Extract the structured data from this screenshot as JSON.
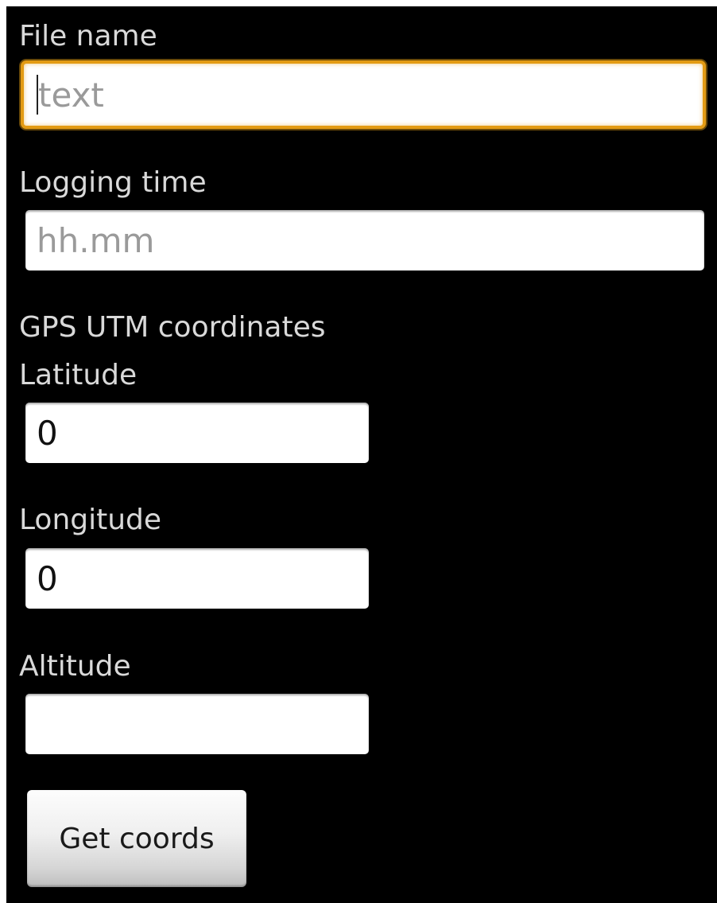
{
  "form": {
    "file_name": {
      "label": "File name",
      "placeholder": "text",
      "value": ""
    },
    "logging_time": {
      "label": "Logging time",
      "placeholder": "hh.mm",
      "value": ""
    },
    "section_title": "GPS UTM coordinates",
    "latitude": {
      "label": "Latitude",
      "value": "0"
    },
    "longitude": {
      "label": "Longitude",
      "value": "0"
    },
    "altitude": {
      "label": "Altitude",
      "value": ""
    },
    "get_coords_label": "Get coords"
  },
  "colors": {
    "background": "#000000",
    "label_text": "#d9d9d9",
    "focus_border": "#e39b14",
    "placeholder_text": "#9a9a9a"
  }
}
